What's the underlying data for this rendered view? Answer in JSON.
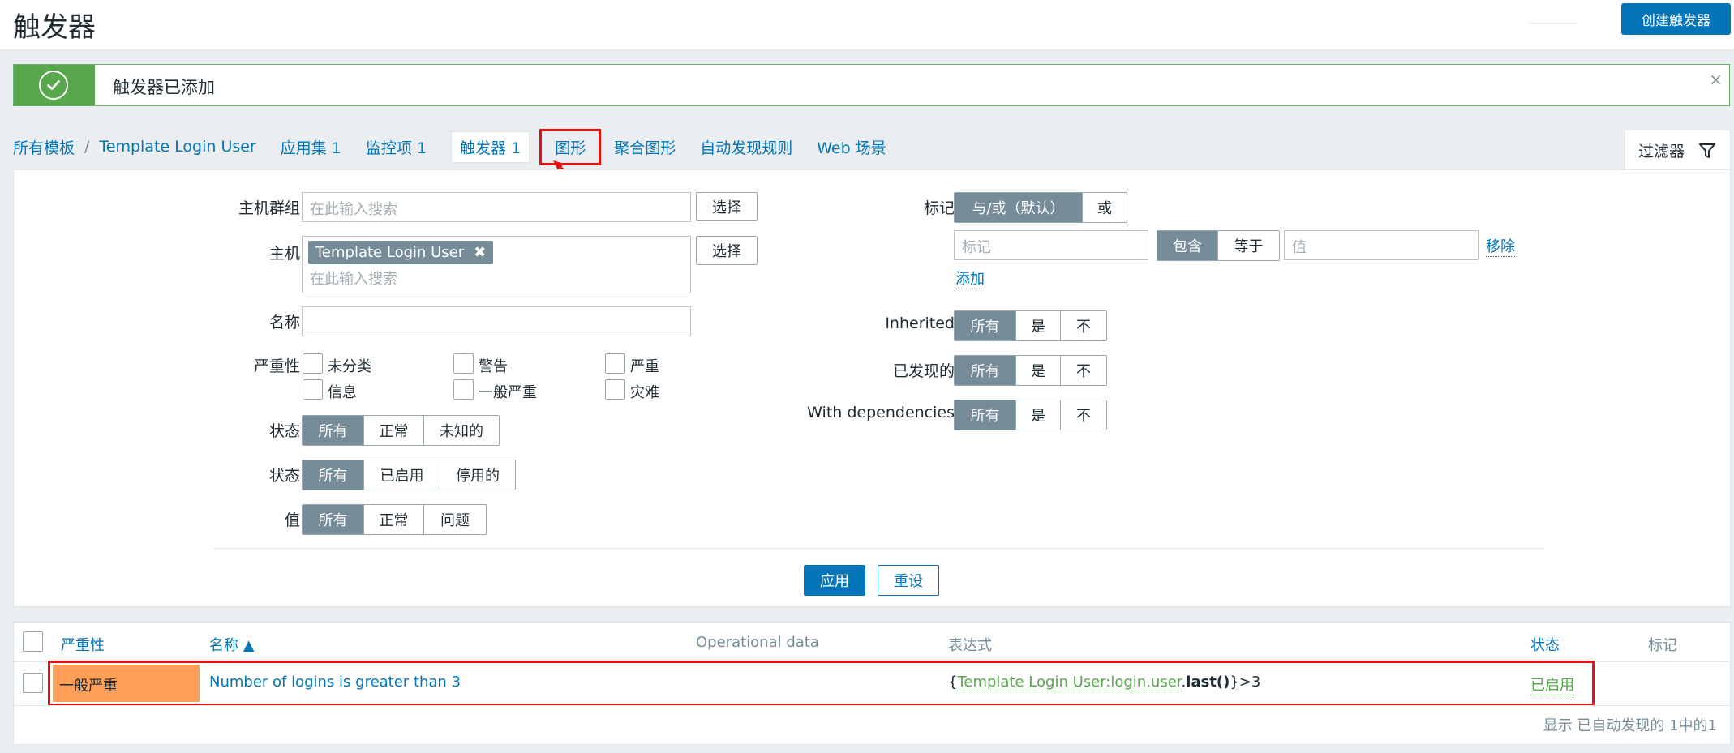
{
  "header": {
    "title": "触发器",
    "create_button": "创建触发器"
  },
  "message": {
    "text": "触发器已添加",
    "close": "×"
  },
  "nav": {
    "all_templates": "所有模板",
    "separator": "/",
    "template": "Template Login User",
    "applications": "应用集 1",
    "items": "监控项 1",
    "triggers": "触发器 1",
    "graphs": "图形",
    "screens": "聚合图形",
    "discovery": "自动发现规则",
    "web": "Web 场景"
  },
  "filter_tab": {
    "label": "过滤器"
  },
  "filter": {
    "host_groups_label": "主机群组",
    "host_groups_placeholder": "在此输入搜索",
    "select_label": "选择",
    "hosts_label": "主机",
    "host_chip": "Template Login User",
    "host_chip_remove": "✖",
    "hosts_placeholder": "在此输入搜索",
    "name_label": "名称",
    "name_value": "",
    "severity_label": "严重性",
    "severities": [
      "未分类",
      "警告",
      "严重",
      "信息",
      "一般严重",
      "灾难"
    ],
    "state_label": "状态",
    "state_options": [
      "所有",
      "正常",
      "未知的"
    ],
    "status_label": "状态",
    "status_options": [
      "所有",
      "已启用",
      "停用的"
    ],
    "value_label": "值",
    "value_options": [
      "所有",
      "正常",
      "问题"
    ],
    "tags_label": "标记",
    "tags_mode": [
      "与/或（默认）",
      "或"
    ],
    "tag_placeholder": "标记",
    "tag_operator": [
      "包含",
      "等于"
    ],
    "tag_value_placeholder": "值",
    "remove_link": "移除",
    "add_link": "添加",
    "inherited_label": "Inherited",
    "discovered_label": "已发现的",
    "dependencies_label": "With dependencies",
    "yes_no_options": [
      "所有",
      "是",
      "不"
    ],
    "apply_button": "应用",
    "reset_button": "重设"
  },
  "table": {
    "columns": {
      "severity": "严重性",
      "name": "名称 ▲",
      "operational": "Operational data",
      "expression": "表达式",
      "status": "状态",
      "tags": "标记"
    },
    "rows": [
      {
        "severity": "一般严重",
        "name": "Number of logins is greater than 3",
        "expr_open": "{",
        "expr_host": "Template Login User:login.user",
        "expr_dot": ".",
        "expr_func": "last()",
        "expr_close": "}>3",
        "status": "已启用"
      }
    ],
    "footer": "显示 已自动发现的 1中的1"
  },
  "colors": {
    "primary": "#0275b8",
    "success": "#59a74c",
    "average_severity": "#ff9f58",
    "annotation_red": "#e3110f"
  }
}
